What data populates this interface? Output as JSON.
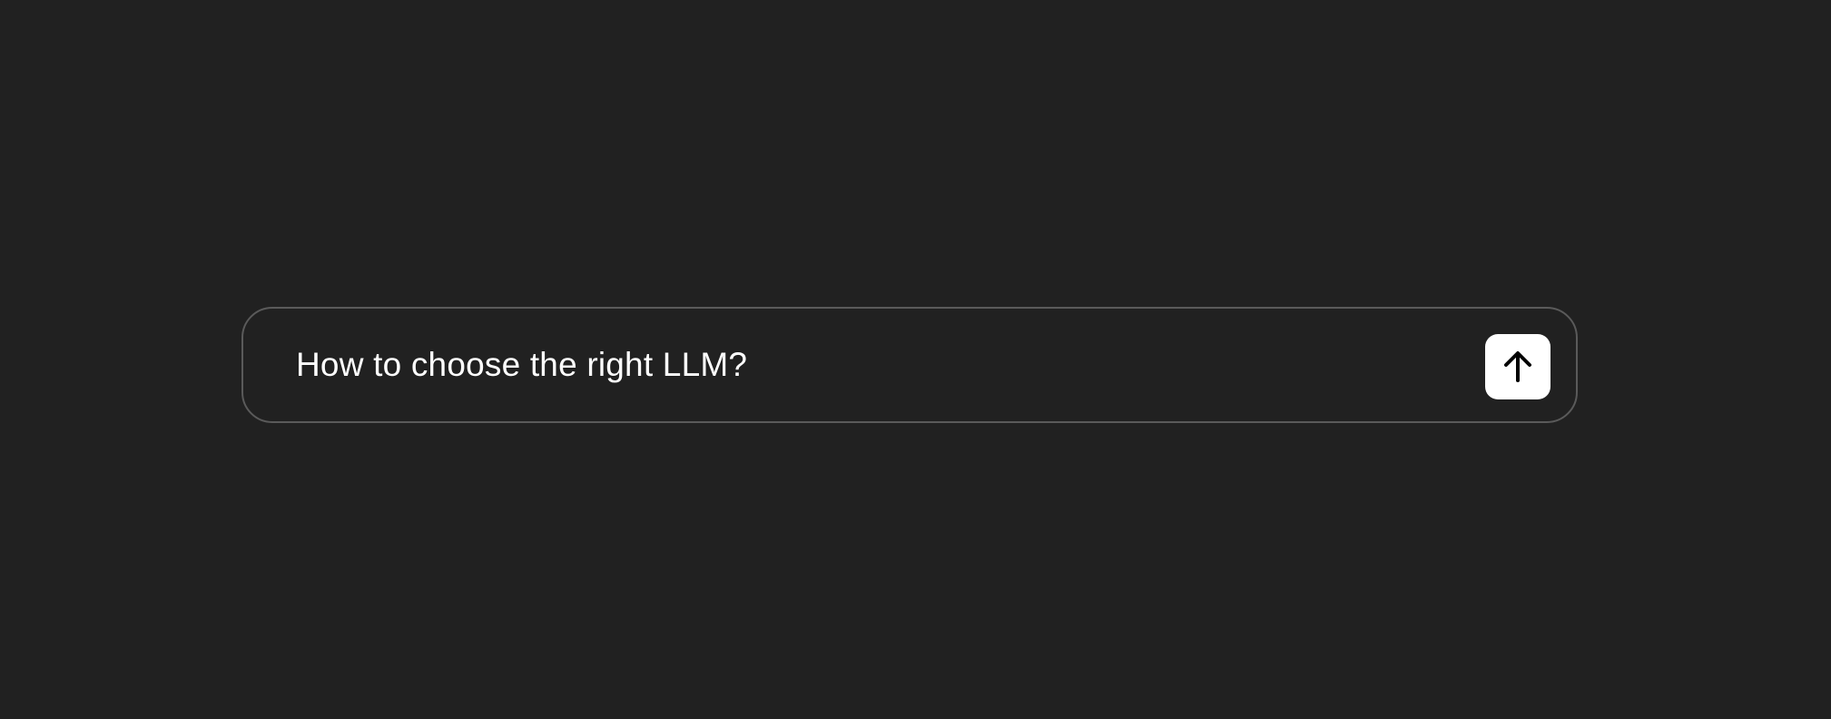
{
  "composer": {
    "input_value": "How to choose the right LLM?",
    "send_icon": "arrow-up-icon",
    "colors": {
      "background": "#212121",
      "border": "#5a5a5a",
      "text": "#ffffff",
      "send_button_bg": "#ffffff",
      "send_icon": "#000000"
    }
  }
}
